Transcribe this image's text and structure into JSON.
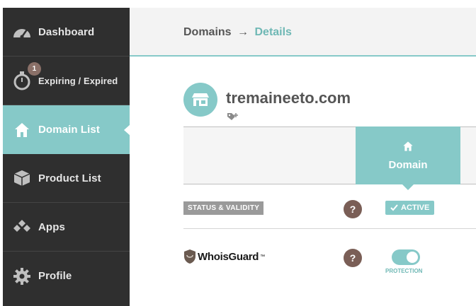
{
  "sidebar": {
    "items": [
      {
        "label": "Dashboard",
        "icon": "speedometer-icon"
      },
      {
        "label": "Expiring / Expired",
        "icon": "stopwatch-icon",
        "badge": "1"
      },
      {
        "label": "Domain List",
        "icon": "home-icon",
        "active": true
      },
      {
        "label": "Product List",
        "icon": "box-icon"
      },
      {
        "label": "Apps",
        "icon": "apps-icon"
      },
      {
        "label": "Profile",
        "icon": "gear-icon"
      }
    ]
  },
  "header": {
    "breadcrumb_root": "Domains",
    "breadcrumb_sep": "→",
    "breadcrumb_current": "Details"
  },
  "domain": {
    "name": "tremaineeto.com"
  },
  "table": {
    "column_label": "Domain",
    "rows": {
      "status": {
        "label": "STATUS & VALIDITY",
        "help": "?",
        "value": "ACTIVE"
      },
      "whoisguard": {
        "label": "WhoisGuard",
        "trademark": "™",
        "help": "?",
        "toggle_label": "PROTECTION",
        "toggle_on": true
      }
    }
  },
  "colors": {
    "accent": "#86c9c8",
    "sidebar_bg": "#2f2f2f",
    "help_bg": "#7a5e56"
  }
}
